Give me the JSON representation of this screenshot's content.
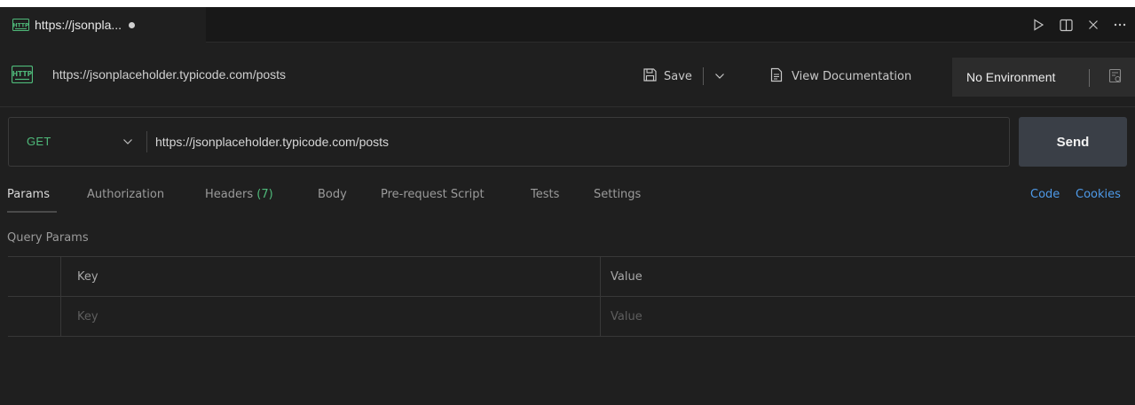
{
  "editor_tab": {
    "title": "https://jsonpla...",
    "icon": "http-file-icon"
  },
  "window_actions": [
    {
      "name": "run-icon",
      "glyph": "▷"
    },
    {
      "name": "split-editor-icon",
      "glyph": "◫"
    },
    {
      "name": "close-icon",
      "glyph": "✕"
    },
    {
      "name": "more-icon",
      "glyph": "···"
    }
  ],
  "request": {
    "title": "https://jsonplaceholder.typicode.com/posts",
    "save_label": "Save",
    "view_docs_label": "View Documentation",
    "environment": "No Environment"
  },
  "url_bar": {
    "method": "GET",
    "url": "https://jsonplaceholder.typicode.com/posts",
    "send_label": "Send"
  },
  "tabs": [
    {
      "label": "Params",
      "active": true
    },
    {
      "label": "Authorization"
    },
    {
      "label": "Headers",
      "count": "(7)"
    },
    {
      "label": "Body"
    },
    {
      "label": "Pre-request Script"
    },
    {
      "label": "Tests"
    },
    {
      "label": "Settings"
    }
  ],
  "links": {
    "code": "Code",
    "cookies": "Cookies"
  },
  "query_params": {
    "label": "Query Params",
    "columns": [
      "Key",
      "Value"
    ],
    "placeholder_row": {
      "key": "Key",
      "value": "Value"
    }
  },
  "colors": {
    "method_get": "#4fba7a",
    "link": "#4e9ae8",
    "send_button": "#3a3f47"
  }
}
